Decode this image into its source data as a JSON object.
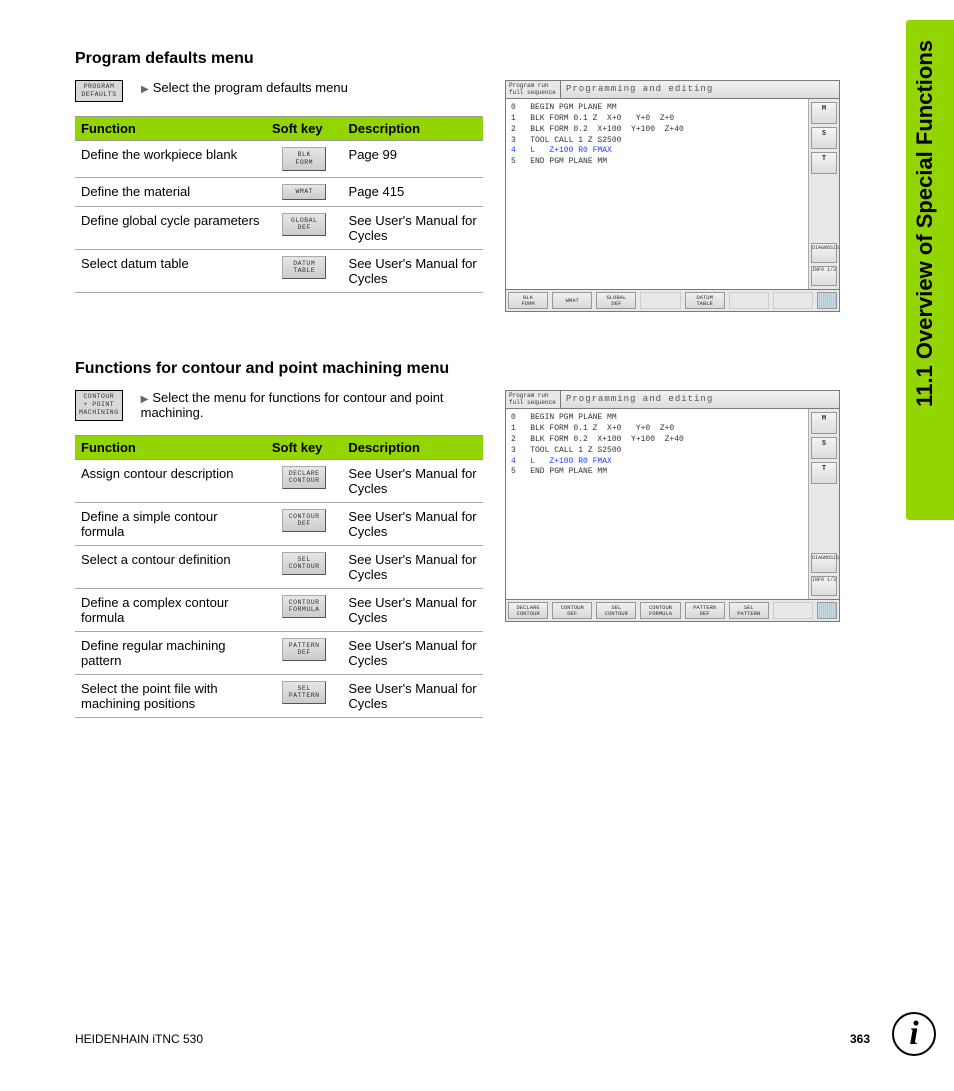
{
  "sideTitle": "11.1 Overview of Special Functions",
  "footer": {
    "left": "HEIDENHAIN iTNC 530",
    "page": "363"
  },
  "infoIcon": "i",
  "section1": {
    "heading": "Program defaults menu",
    "intro": "Select the program defaults menu",
    "introKey": "PROGRAM\nDEFAULTS",
    "th": {
      "func": "Function",
      "sk": "Soft key",
      "desc": "Description"
    },
    "rows": [
      {
        "func": "Define the workpiece blank",
        "sk": "BLK\nFORM",
        "desc": "Page 99"
      },
      {
        "func": "Define the material",
        "sk": "WMAT",
        "desc": "Page 415"
      },
      {
        "func": "Define global cycle parameters",
        "sk": "GLOBAL\nDEF",
        "desc": "See User's Manual for Cycles"
      },
      {
        "func": "Select datum table",
        "sk": "DATUM\nTABLE",
        "desc": "See User's Manual for Cycles"
      }
    ]
  },
  "section2": {
    "heading": "Functions for contour and point machining menu",
    "intro": "Select the menu for functions for contour and point machining.",
    "introKey": "CONTOUR\n+ POINT\nMACHINING",
    "th": {
      "func": "Function",
      "sk": "Soft key",
      "desc": "Description"
    },
    "rows": [
      {
        "func": "Assign contour description",
        "sk": "DECLARE\nCONTOUR",
        "desc": "See User's Manual for Cycles"
      },
      {
        "func": "Define a simple contour formula",
        "sk": "CONTOUR\nDEF",
        "desc": "See User's Manual for Cycles"
      },
      {
        "func": "Select a contour definition",
        "sk": "SEL\nCONTOUR",
        "desc": "See User's Manual for Cycles"
      },
      {
        "func": "Define a complex contour formula",
        "sk": "CONTOUR\nFORMULA",
        "desc": "See User's Manual for Cycles"
      },
      {
        "func": "Define regular machining pattern",
        "sk": "PATTERN\nDEF",
        "desc": "See User's Manual for Cycles"
      },
      {
        "func": "Select the point file with machining positions",
        "sk": "SEL\nPATTERN",
        "desc": "See User's Manual for Cycles"
      }
    ]
  },
  "panel": {
    "mode": "Program run\nfull sequence",
    "title": "Programming and editing",
    "listingPlain": "0   BEGIN PGM PLANE MM\n1   BLK FORM 0.1 Z  X+0   Y+0  Z+0\n2   BLK FORM 0.2  X+100  Y+100  Z+40\n3   TOOL CALL 1 Z S2500\n",
    "listingHL": "4   L   Z+100 R0 FMAX\n",
    "listingEnd": "5   END PGM PLANE MM",
    "side": {
      "m": "M",
      "s": "S",
      "t": "T",
      "diag": "DIAGNOSIS",
      "info": "INFO 1/3"
    }
  },
  "panel1Softkeys": [
    "BLK\nFORM",
    "WMAT",
    "GLOBAL\nDEF",
    "",
    "DATUM\nTABLE",
    "",
    ""
  ],
  "panel2Softkeys": [
    "DECLARE\nCONTOUR",
    "CONTOUR\nDEF",
    "SEL\nCONTOUR",
    "CONTOUR\nFORMULA",
    "PATTERN\nDEF",
    "SEL\nPATTERN",
    ""
  ]
}
